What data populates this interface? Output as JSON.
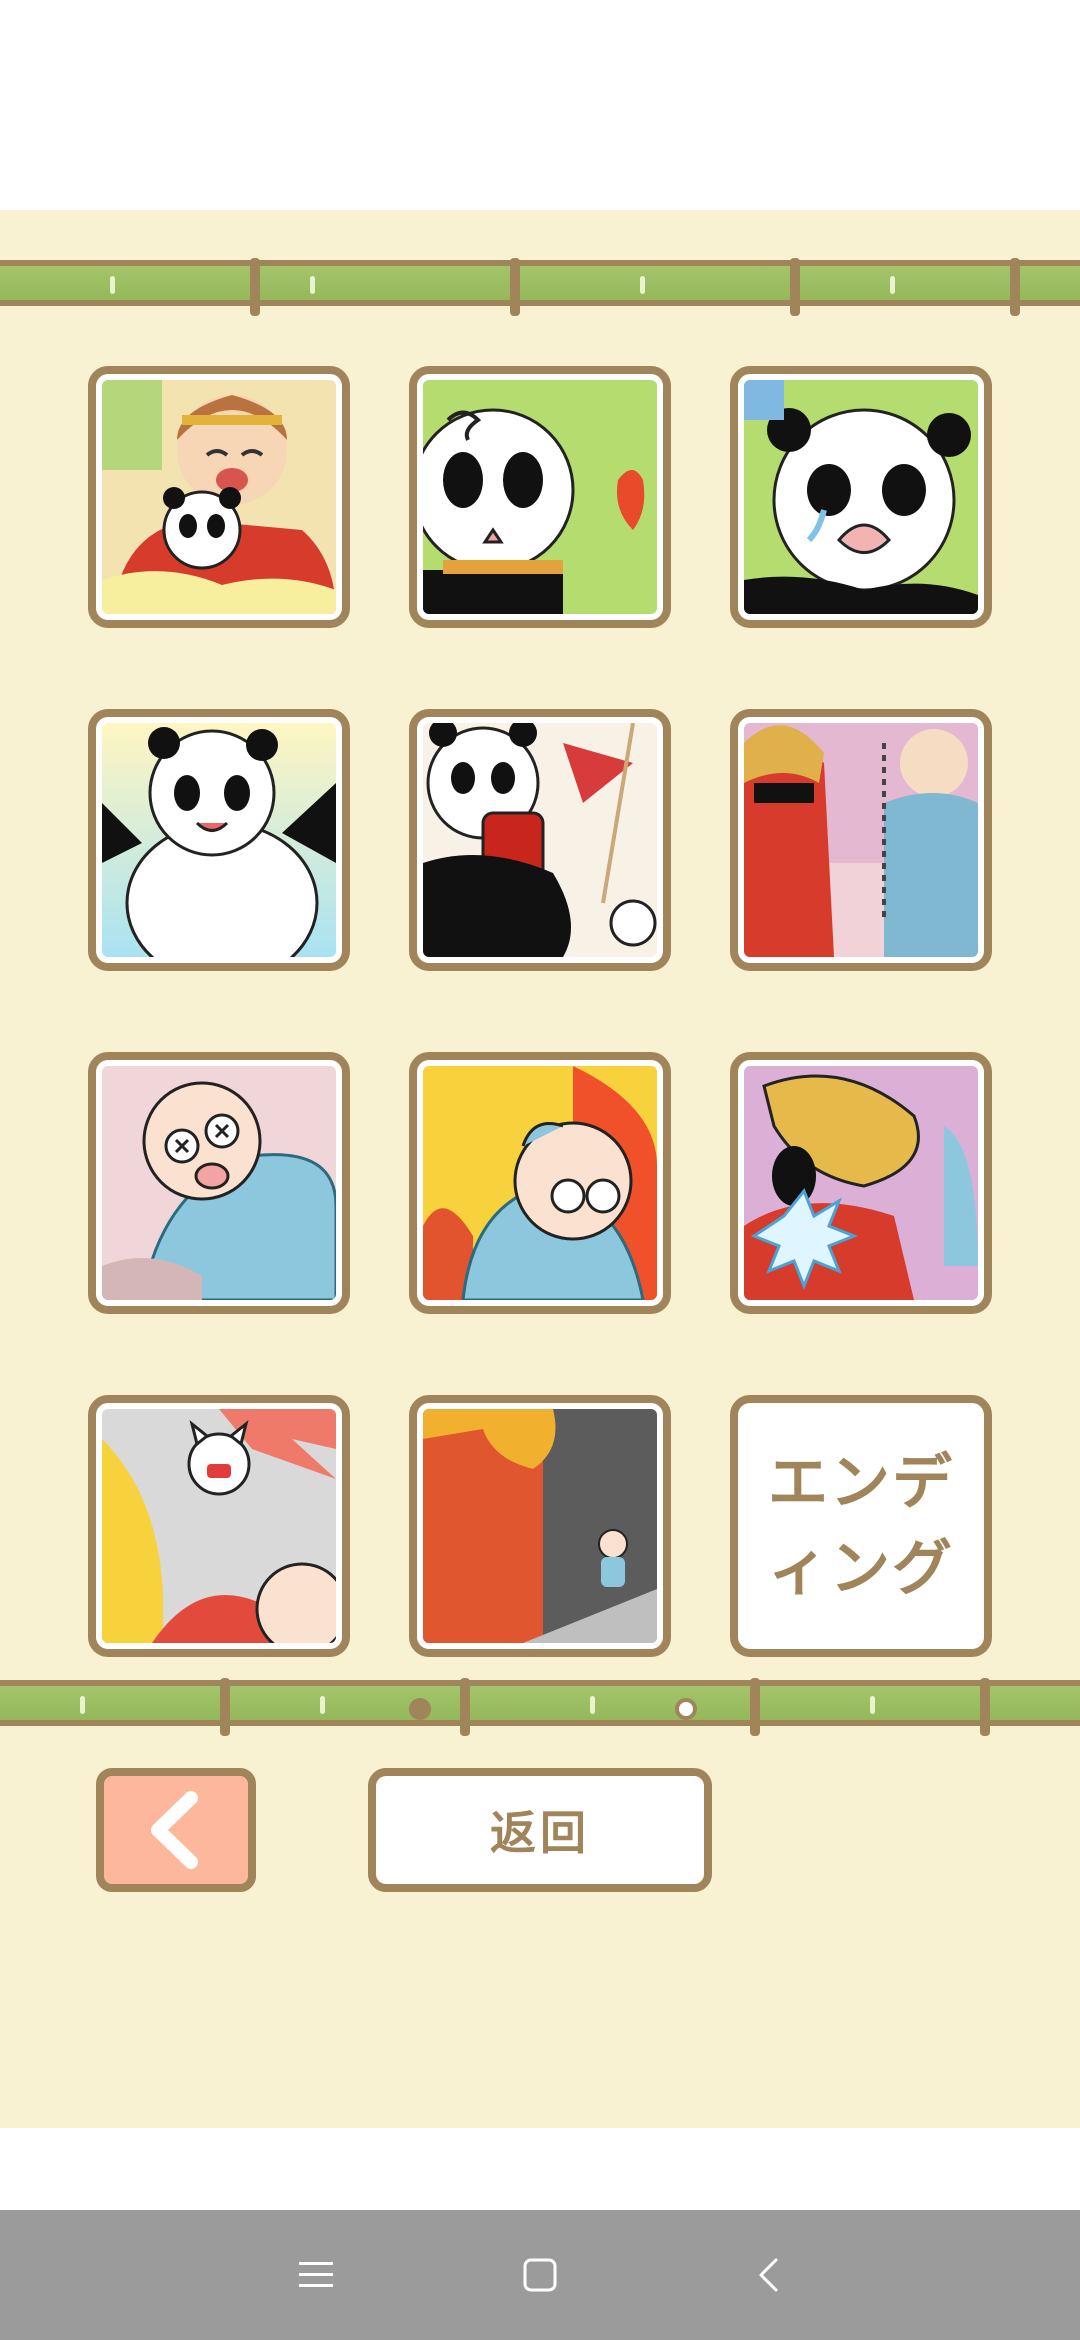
{
  "gallery": {
    "tiles": [
      {
        "name": "memory-tile-1",
        "scene": "monkey-king-hugging-panda"
      },
      {
        "name": "memory-tile-2",
        "scene": "dizzy-panda"
      },
      {
        "name": "memory-tile-3",
        "scene": "crying-panda"
      },
      {
        "name": "memory-tile-4",
        "scene": "happy-panda-arms-up"
      },
      {
        "name": "memory-tile-5",
        "scene": "panda-with-barrel"
      },
      {
        "name": "memory-tile-6",
        "scene": "workers-scene"
      },
      {
        "name": "memory-tile-7",
        "scene": "old-man-knocked-out"
      },
      {
        "name": "memory-tile-8",
        "scene": "old-man-in-fire"
      },
      {
        "name": "memory-tile-9",
        "scene": "blond-man-hit"
      },
      {
        "name": "memory-tile-10",
        "scene": "angry-cat-shout"
      },
      {
        "name": "memory-tile-11",
        "scene": "dark-corridor"
      }
    ],
    "ending_label": "エンディング"
  },
  "pagination": {
    "current_page": 1,
    "total_pages": 2
  },
  "buttons": {
    "back_label": "返回"
  },
  "colors": {
    "background": "#f8f1d2",
    "frame_brown": "#a0845a",
    "bamboo_green": "#9ebf62",
    "prev_button": "#fdb79d",
    "nav_bar": "#9b9b9b"
  }
}
